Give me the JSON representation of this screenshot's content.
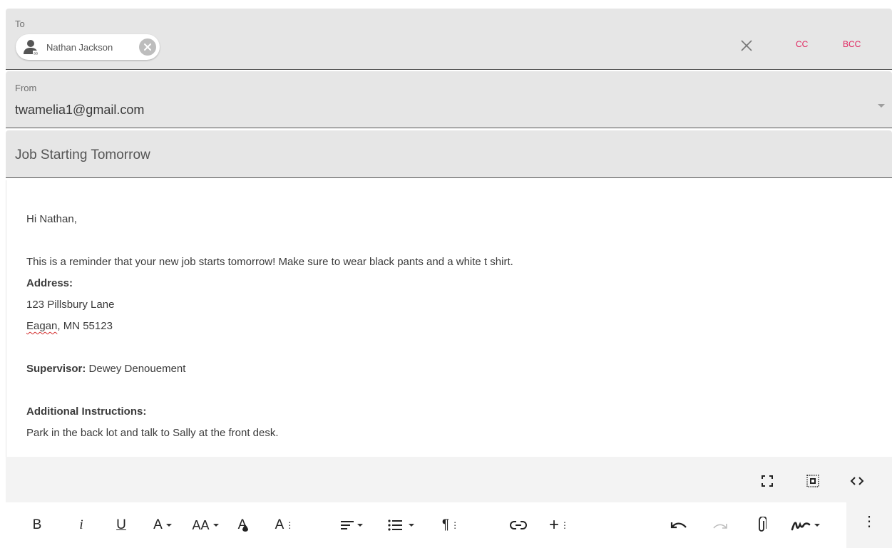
{
  "to": {
    "label": "To",
    "recipients": [
      {
        "name": "Nathan Jackson"
      }
    ],
    "clear_icon": "close-icon",
    "cc_label": "CC",
    "bcc_label": "BCC"
  },
  "from": {
    "label": "From",
    "value": "twamelia1@gmail.com"
  },
  "subject": {
    "value": "Job Starting Tomorrow"
  },
  "body": {
    "greeting": "Hi Nathan,",
    "intro": "This is a reminder that your new job starts tomorrow! Make sure to wear black pants and a white t shirt.",
    "address_heading": "Address:",
    "address_line1": "123 Pillsbury Lane",
    "address_city": "Eagan",
    "address_rest": ", MN 55123",
    "supervisor_label": "Supervisor:",
    "supervisor_value": " Dewey Denouement",
    "instructions_heading": "Additional Instructions:",
    "instructions_text": "Park in the back lot and talk to Sally at the front desk."
  },
  "view_tools": [
    "fullscreen-icon",
    "select-all-icon",
    "code-view-icon"
  ],
  "toolbar": {
    "bold": "B",
    "italic": "i",
    "underline": "U",
    "font_color": "A",
    "font_size": "AA",
    "clear_format": "A",
    "text_style": "A",
    "more_misc": "+",
    "paragraph": "¶",
    "icons": [
      "bold-icon",
      "italic-icon",
      "underline-icon",
      "font-color-icon",
      "font-size-icon",
      "highlight-icon",
      "text-style-icon",
      "align-icon",
      "list-icon",
      "paragraph-format-icon",
      "link-icon",
      "insert-more-icon",
      "undo-icon",
      "redo-icon",
      "attachment-icon",
      "signature-icon",
      "more-vert-icon"
    ]
  },
  "colors": {
    "accent": "#e0245e",
    "field_bg": "#e6e6e6",
    "toolbar_bg": "#f3f3f3"
  }
}
